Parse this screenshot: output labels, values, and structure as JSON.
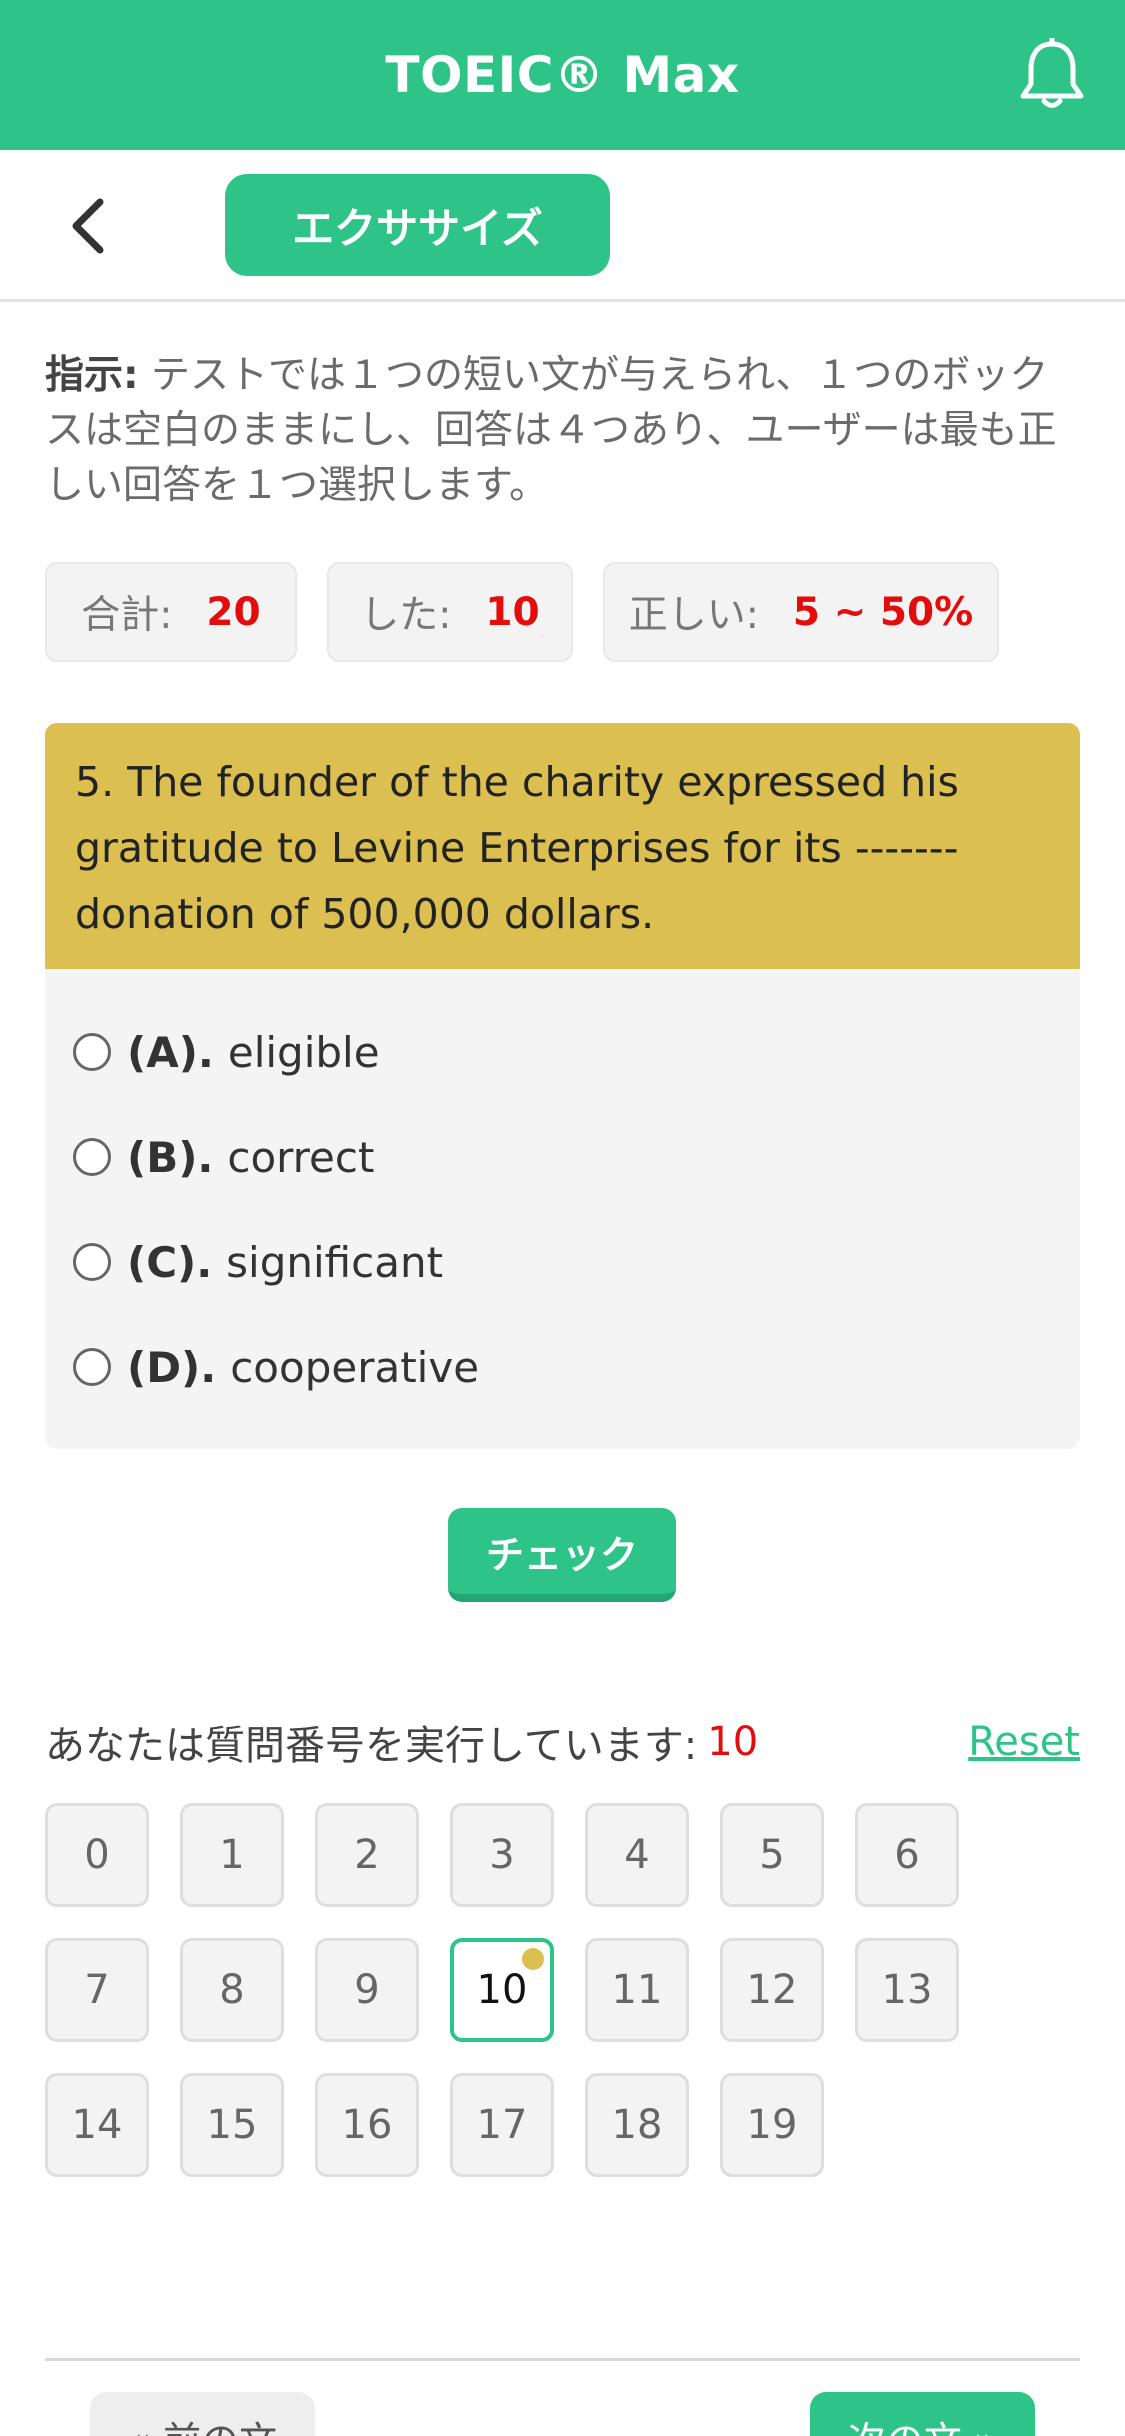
{
  "header": {
    "title": "TOEIC® Max",
    "bell_icon": "bell-icon"
  },
  "subnav": {
    "back_icon": "chevron-left-icon",
    "tab_label": "エクササイズ"
  },
  "instruction": {
    "label": "指示:",
    "text": " テストでは１つの短い文が与えられ、１つのボックスは空白のままにし、回答は４つあり、ユーザーは最も正しい回答を１つ選択します。"
  },
  "stats": {
    "total_label": "合計:",
    "total_value": "20",
    "done_label": "した:",
    "done_value": "10",
    "correct_label": "正しい:",
    "correct_value": "5 ~ 50%"
  },
  "question": {
    "text": "5. The founder of the charity expressed his gratitude to Levine Enterprises for its ------- donation of 500,000 dollars.",
    "options": [
      {
        "key": "(A).",
        "text": "eligible"
      },
      {
        "key": "(B).",
        "text": "correct"
      },
      {
        "key": "(C).",
        "text": "significant"
      },
      {
        "key": "(D).",
        "text": "cooperative"
      }
    ]
  },
  "check_label": "チェック",
  "progress": {
    "label": "あなたは質問番号を実行しています:",
    "current": "10",
    "reset_label": "Reset"
  },
  "numbers": [
    "0",
    "1",
    "2",
    "3",
    "4",
    "5",
    "6",
    "7",
    "8",
    "9",
    "10",
    "11",
    "12",
    "13",
    "14",
    "15",
    "16",
    "17",
    "18",
    "19"
  ],
  "nav": {
    "prev_label": "« 前の文",
    "next_label": "次の文 »"
  },
  "colors": {
    "brand": "#2ec488",
    "question_bg": "#dbbf50",
    "highlight": "#e30d0d"
  }
}
